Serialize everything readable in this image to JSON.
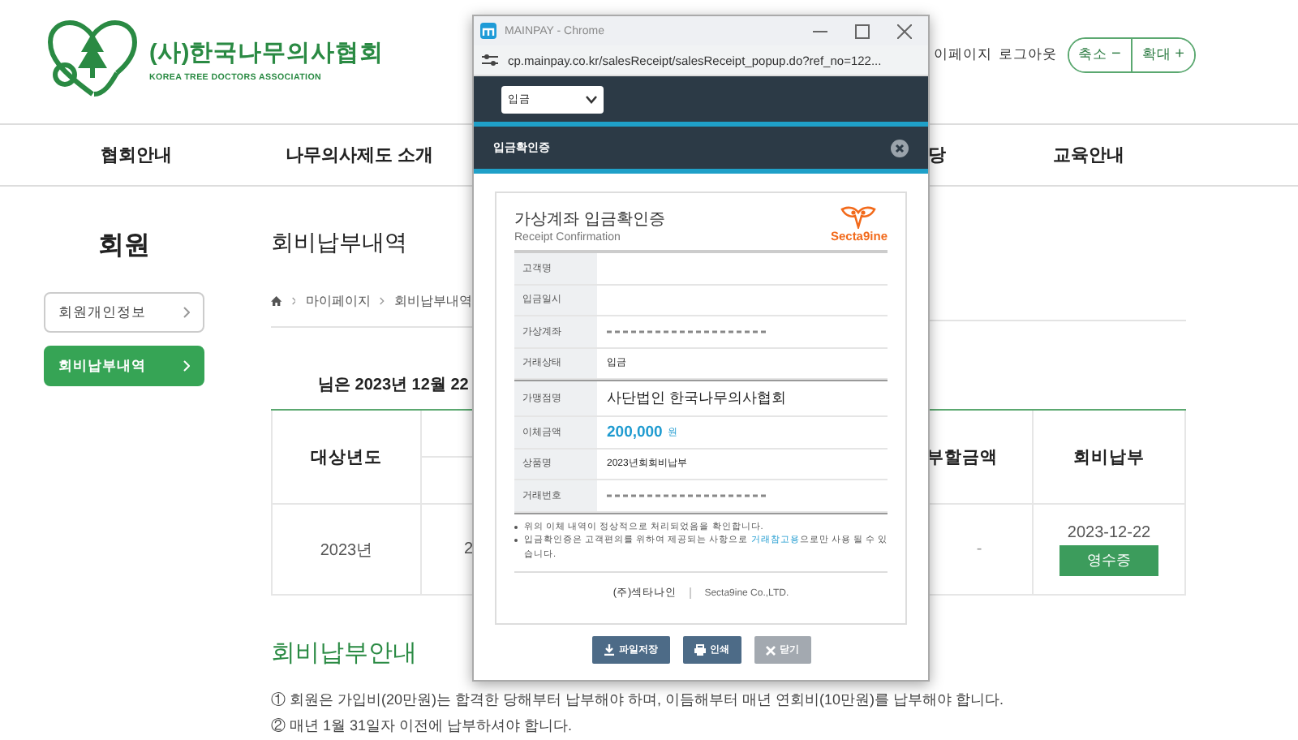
{
  "logo": {
    "name": "(사)한국나무의사협회",
    "subtitle": "KOREA TREE DOCTORS ASSOCIATION"
  },
  "header_links": [
    "이페이지",
    "로그아웃"
  ],
  "zoom_controls": [
    {
      "label": "축소",
      "sign": "−"
    },
    {
      "label": "확대",
      "sign": "+"
    }
  ],
  "nav": {
    "items": [
      "협회안내",
      "나무의사제도 소개"
    ],
    "partial_item": "당",
    "last_item": "교육안내"
  },
  "sidebar": {
    "title": "회원",
    "items": [
      {
        "label": "회원개인정보",
        "selected": false
      },
      {
        "label": "회비납부내역",
        "selected": true
      }
    ]
  },
  "main": {
    "title": "회비납부내역",
    "breadcrumb": [
      "마이페이지",
      "회비납부내역"
    ],
    "notice": "님은 2023년 12월 22",
    "table": {
      "columns": [
        "대상년도",
        "",
        "부할금액",
        "회비납부"
      ],
      "row": {
        "year": "2023년",
        "column_2": "2",
        "amount": "-",
        "date": "2023-12-22",
        "button": "영수증"
      }
    },
    "guide_title": "회비납부안내",
    "guide_lines": [
      "① 회원은 가입비(20만원)는 합격한 당해부터 납부해야 하며, 이듬해부터 매년 연회비(10만원)를 납부해야 합니다.",
      "② 매년 1월 31일자 이전에 납부하셔야 합니다."
    ]
  },
  "popup": {
    "window_title": "MAINPAY - Chrome",
    "url": "cp.mainpay.co.kr/salesReceipt/salesReceipt_popup.do?ref_no=122...",
    "select_value": "입금",
    "header": "입금확인증",
    "receipt": {
      "title": "가상계좌 입금확인증",
      "subtitle": "Receipt Confirmation",
      "brand": "Secta9ine",
      "rows": [
        {
          "label": "고객명",
          "kind": "empty"
        },
        {
          "label": "입금일시",
          "kind": "empty"
        },
        {
          "label": "가상계좌",
          "kind": "masked"
        },
        {
          "label": "거래상태",
          "kind": "text",
          "value": "입금"
        },
        {
          "label": "가맹점명",
          "kind": "large",
          "value": "사단법인 한국나무의사협회"
        },
        {
          "label": "이체금액",
          "kind": "amount",
          "value": "200,000",
          "unit": "원"
        },
        {
          "label": "상품명",
          "kind": "text",
          "value": "2023년회회비납부"
        },
        {
          "label": "거래번호",
          "kind": "masked"
        }
      ],
      "notes": [
        {
          "before": "위의 이체 내역이 정상적으로 처리되었음을 확인합니다."
        },
        {
          "before": "입금확인증은 고객편의를 위하여 제공되는 사항으로 ",
          "link": "거래참고용",
          "after": "으로만 사용 될 수 있습니다."
        }
      ],
      "company_ko": "(주)섹타나인",
      "company_en": "Secta9ine Co.,LTD."
    },
    "buttons": [
      {
        "label": "파일저장",
        "kind": "save"
      },
      {
        "label": "인쇄",
        "kind": "print"
      },
      {
        "label": "닫기",
        "kind": "close"
      }
    ]
  }
}
